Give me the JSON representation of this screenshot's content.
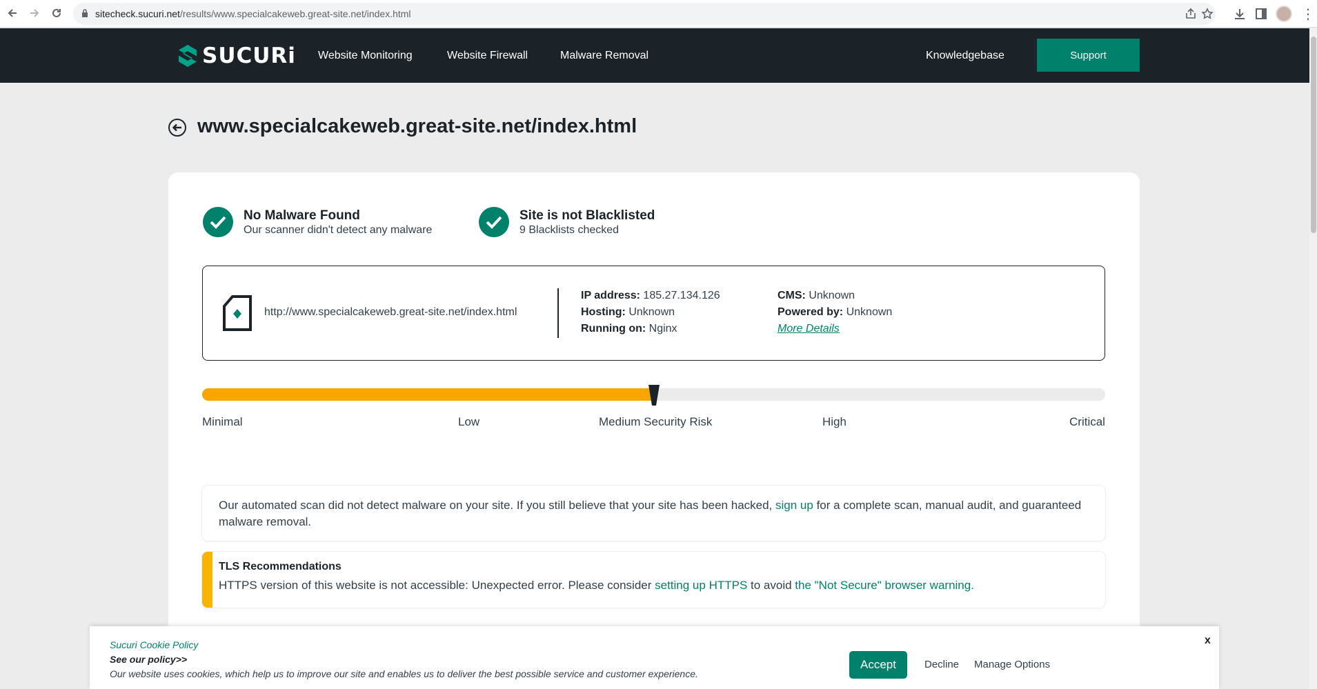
{
  "browser": {
    "url_host": "sitecheck.sucuri.net",
    "url_path": "/results/www.specialcakeweb.great-site.net/index.html"
  },
  "header": {
    "logo_text": "SUCURi",
    "nav": [
      "Website Monitoring",
      "Website Firewall",
      "Malware Removal"
    ],
    "knowledgebase": "Knowledgebase",
    "support": "Support"
  },
  "page": {
    "title": "www.specialcakeweb.great-site.net/index.html"
  },
  "status": {
    "malware_title": "No Malware Found",
    "malware_sub": "Our scanner didn't detect any malware",
    "blacklist_title": "Site is not Blacklisted",
    "blacklist_sub": "9 Blacklists checked"
  },
  "site_info": {
    "url": "http://www.specialcakeweb.great-site.net/index.html",
    "ip_label": "IP address:",
    "ip_value": "185.27.134.126",
    "hosting_label": "Hosting:",
    "hosting_value": "Unknown",
    "running_label": "Running on:",
    "running_value": "Nginx",
    "cms_label": "CMS:",
    "cms_value": "Unknown",
    "powered_label": "Powered by:",
    "powered_value": "Unknown",
    "more_details": "More Details"
  },
  "risk": {
    "level_fraction": 0.5,
    "labels": [
      "Minimal",
      "Low",
      "Medium Security Risk",
      "High",
      "Critical"
    ],
    "fill_color": "#f8a500"
  },
  "notice": {
    "text_before": "Our automated scan did not detect malware on your site. If you still believe that your site has been hacked, ",
    "link": "sign up",
    "text_after": " for a complete scan, manual audit, and guaranteed malware removal."
  },
  "tls": {
    "title": "TLS Recommendations",
    "text_before": "HTTPS version of this website is not accessible: Unexpected error. Please consider ",
    "link1": "setting up HTTPS",
    "text_mid": " to avoid ",
    "link2": "the \"Not Secure\" browser warning."
  },
  "cookie": {
    "policy": "Sucuri Cookie Policy",
    "see": "See our policy>>",
    "desc": "Our website uses cookies, which help us to improve our site and enables us to deliver the best possible service and customer experience.",
    "accept": "Accept",
    "decline": "Decline",
    "manage": "Manage Options",
    "close": "x"
  },
  "colors": {
    "brand": "#00816c",
    "header_bg": "#1c2328",
    "warning": "#f8b400"
  }
}
